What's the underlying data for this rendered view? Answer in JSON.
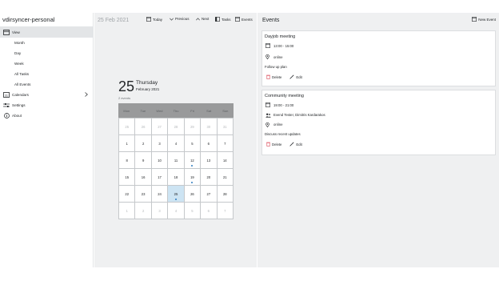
{
  "sidebar": {
    "title": "vdirsyncer-personal",
    "view_label": "View",
    "view_items": [
      "Month",
      "Day",
      "Week",
      "All Tasks",
      "All Events"
    ],
    "calendars_label": "Calendars",
    "settings_label": "Settings",
    "about_label": "About"
  },
  "center": {
    "date_title": "25 Feb 2021",
    "toolbar": {
      "today": "Today",
      "previous": "Previous",
      "next": "Next",
      "tasks": "Tasks",
      "events": "Events"
    },
    "day_number": "25",
    "weekday": "Thursday",
    "month_year": "February 2021",
    "events_count": "2 events",
    "weekdays": [
      "Mon",
      "Tue",
      "Wed",
      "Thu",
      "Fri",
      "Sat",
      "Sun"
    ],
    "days": [
      {
        "d": "25",
        "other": true
      },
      {
        "d": "26",
        "other": true
      },
      {
        "d": "27",
        "other": true
      },
      {
        "d": "28",
        "other": true
      },
      {
        "d": "29",
        "other": true
      },
      {
        "d": "30",
        "other": true
      },
      {
        "d": "31",
        "other": true
      },
      {
        "d": "1"
      },
      {
        "d": "2"
      },
      {
        "d": "3"
      },
      {
        "d": "4"
      },
      {
        "d": "5"
      },
      {
        "d": "6"
      },
      {
        "d": "7"
      },
      {
        "d": "8"
      },
      {
        "d": "9"
      },
      {
        "d": "10"
      },
      {
        "d": "11"
      },
      {
        "d": "12",
        "dot": true
      },
      {
        "d": "13"
      },
      {
        "d": "14"
      },
      {
        "d": "15"
      },
      {
        "d": "16"
      },
      {
        "d": "17"
      },
      {
        "d": "18"
      },
      {
        "d": "19",
        "dot": true
      },
      {
        "d": "20"
      },
      {
        "d": "21"
      },
      {
        "d": "22"
      },
      {
        "d": "23"
      },
      {
        "d": "24"
      },
      {
        "d": "25",
        "selected": true,
        "dot": true
      },
      {
        "d": "26"
      },
      {
        "d": "27"
      },
      {
        "d": "28"
      },
      {
        "d": "1",
        "other": true
      },
      {
        "d": "2",
        "other": true
      },
      {
        "d": "3",
        "other": true
      },
      {
        "d": "4",
        "other": true
      },
      {
        "d": "5",
        "other": true
      },
      {
        "d": "6",
        "other": true
      },
      {
        "d": "7",
        "other": true
      }
    ]
  },
  "events_panel": {
    "title": "Events",
    "new_event": "New Event",
    "cards": [
      {
        "title": "Dayjob meeting",
        "time": "13:00 - 15:00",
        "location": "online",
        "description": "Follow up plan",
        "delete": "Delete",
        "edit": "Edit"
      },
      {
        "title": "Community meeting",
        "time": "19:00 - 21:00",
        "attendees": "Evend Tester, Dimitris Kardarakos",
        "location": "online",
        "description": "Discuss recent updates",
        "delete": "Delete",
        "edit": "Edit"
      }
    ]
  },
  "colors": {
    "accent": "#2e7cc0",
    "selected_day": "#cde4f3",
    "delete_red": "#da4453"
  }
}
